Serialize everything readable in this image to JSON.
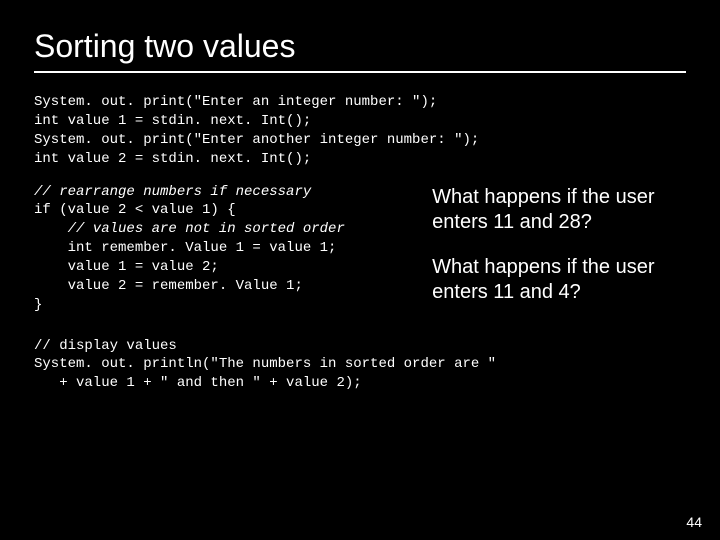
{
  "title": "Sorting two values",
  "code1": {
    "l1": "System. out. print(\"Enter an integer number: \");",
    "l2": "int value 1 = stdin. next. Int();",
    "l3": "System. out. print(\"Enter another integer number: \");",
    "l4": "int value 2 = stdin. next. Int();"
  },
  "code2": {
    "c1": "// rearrange numbers if necessary",
    "l2": "if (value 2 < value 1) {",
    "c3": "    // values are not in sorted order",
    "l4": "    int remember. Value 1 = value 1;",
    "l5": "    value 1 = value 2;",
    "l6": "    value 2 = remember. Value 1;",
    "l7": "}"
  },
  "q1": "What happens if the user enters 11 and 28?",
  "q2": "What happens if the user enters 11 and 4?",
  "code3": {
    "c1": "// display values",
    "l2": "System. out. println(\"The numbers in sorted order are \"",
    "l3": "   + value 1 + \" and then \" + value 2);"
  },
  "page": "44"
}
